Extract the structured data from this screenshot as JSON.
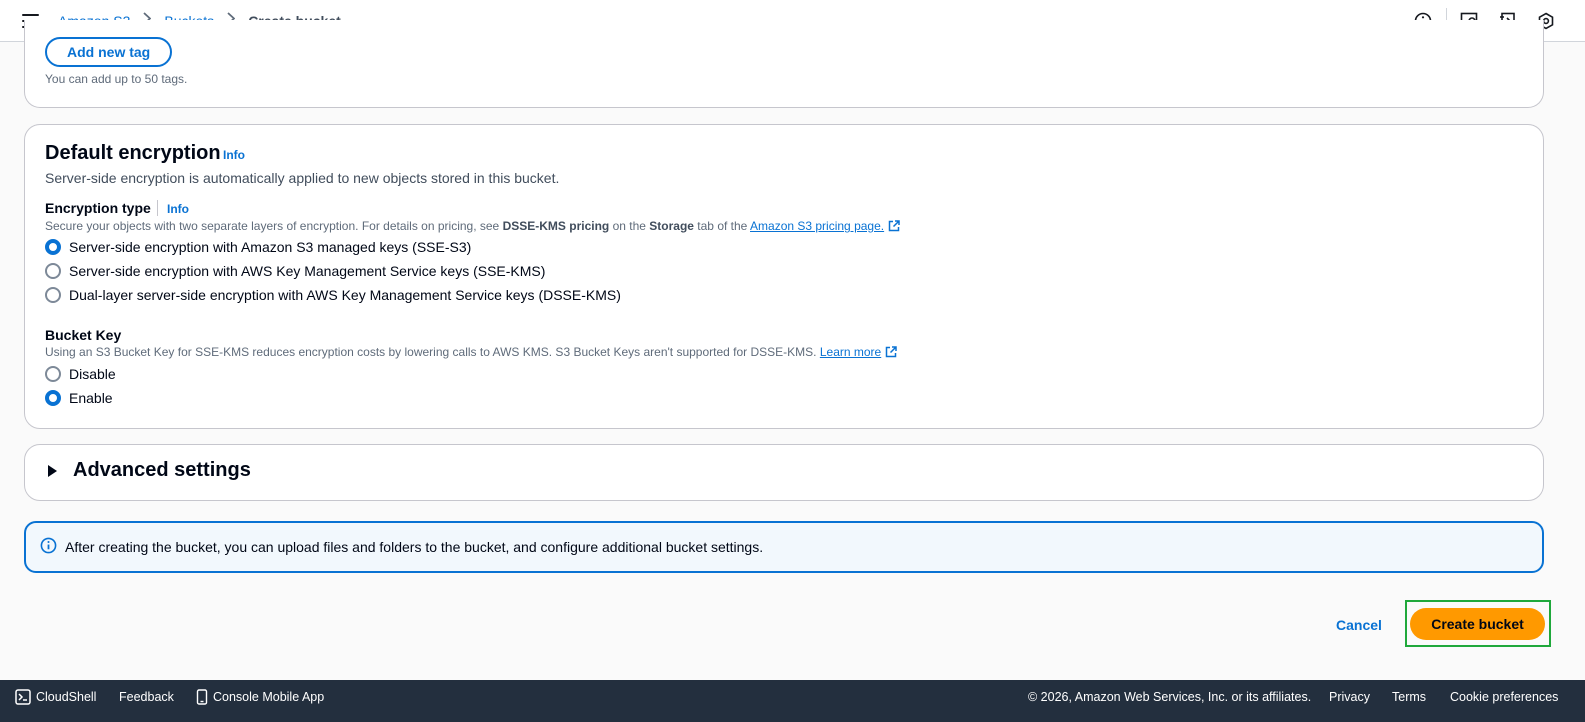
{
  "breadcrumb": {
    "items": [
      "Amazon S3",
      "Buckets"
    ],
    "current": "Create bucket"
  },
  "tags": {
    "add_button": "Add new tag",
    "hint": "You can add up to 50 tags."
  },
  "encryption": {
    "title": "Default encryption",
    "info": "Info",
    "description": "Server-side encryption is automatically applied to new objects stored in this bucket.",
    "type_label": "Encryption type",
    "type_info": "Info",
    "type_desc_1": "Secure your objects with two separate layers of encryption. For details on pricing, see ",
    "type_desc_bold_1": "DSSE-KMS pricing",
    "type_desc_2": " on the ",
    "type_desc_bold_2": "Storage",
    "type_desc_3": " tab of the ",
    "type_desc_link": "Amazon S3 pricing page.",
    "options": [
      {
        "label": "Server-side encryption with Amazon S3 managed keys (SSE-S3)",
        "checked": true
      },
      {
        "label": "Server-side encryption with AWS Key Management Service keys (SSE-KMS)",
        "checked": false
      },
      {
        "label": "Dual-layer server-side encryption with AWS Key Management Service keys (DSSE-KMS)",
        "checked": false
      }
    ],
    "bucket_key_label": "Bucket Key",
    "bucket_key_desc": "Using an S3 Bucket Key for SSE-KMS reduces encryption costs by lowering calls to AWS KMS. S3 Bucket Keys aren't supported for DSSE-KMS. ",
    "bucket_key_link": "Learn more",
    "bucket_key_options": [
      {
        "label": "Disable",
        "checked": false
      },
      {
        "label": "Enable",
        "checked": true
      }
    ]
  },
  "advanced": {
    "title": "Advanced settings"
  },
  "alert": {
    "text": "After creating the bucket, you can upload files and folders to the bucket, and configure additional bucket settings."
  },
  "actions": {
    "cancel": "Cancel",
    "create": "Create bucket"
  },
  "footer": {
    "cloudshell": "CloudShell",
    "feedback": "Feedback",
    "mobile_app": "Console Mobile App",
    "copyright": "© 2026, Amazon Web Services, Inc. or its affiliates.",
    "privacy": "Privacy",
    "terms": "Terms",
    "cookies": "Cookie preferences"
  },
  "colors": {
    "link": "#0972d3",
    "primary_button": "#ff9900",
    "highlight": "#1fa83b",
    "footer_bg": "#232f3e"
  }
}
